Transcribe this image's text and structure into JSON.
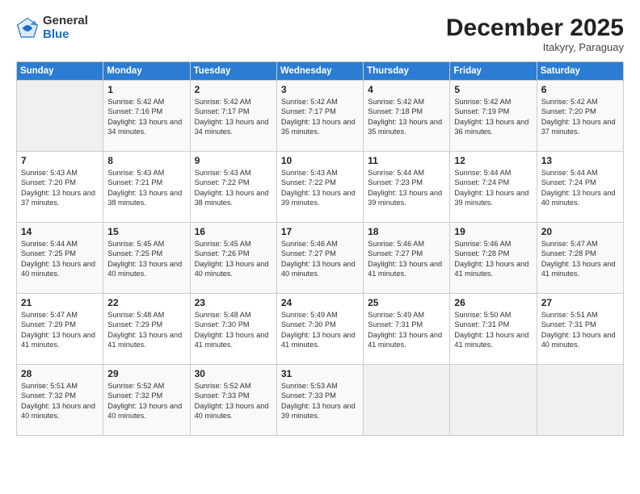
{
  "header": {
    "logo_general": "General",
    "logo_blue": "Blue",
    "month": "December 2025",
    "location": "Itakyry, Paraguay"
  },
  "days_of_week": [
    "Sunday",
    "Monday",
    "Tuesday",
    "Wednesday",
    "Thursday",
    "Friday",
    "Saturday"
  ],
  "weeks": [
    [
      {
        "day": "",
        "info": ""
      },
      {
        "day": "1",
        "sunrise": "5:42 AM",
        "sunset": "7:16 PM",
        "daylight": "13 hours and 34 minutes."
      },
      {
        "day": "2",
        "sunrise": "5:42 AM",
        "sunset": "7:17 PM",
        "daylight": "13 hours and 34 minutes."
      },
      {
        "day": "3",
        "sunrise": "5:42 AM",
        "sunset": "7:17 PM",
        "daylight": "13 hours and 35 minutes."
      },
      {
        "day": "4",
        "sunrise": "5:42 AM",
        "sunset": "7:18 PM",
        "daylight": "13 hours and 35 minutes."
      },
      {
        "day": "5",
        "sunrise": "5:42 AM",
        "sunset": "7:19 PM",
        "daylight": "13 hours and 36 minutes."
      },
      {
        "day": "6",
        "sunrise": "5:42 AM",
        "sunset": "7:20 PM",
        "daylight": "13 hours and 37 minutes."
      }
    ],
    [
      {
        "day": "7",
        "sunrise": "5:43 AM",
        "sunset": "7:20 PM",
        "daylight": "13 hours and 37 minutes."
      },
      {
        "day": "8",
        "sunrise": "5:43 AM",
        "sunset": "7:21 PM",
        "daylight": "13 hours and 38 minutes."
      },
      {
        "day": "9",
        "sunrise": "5:43 AM",
        "sunset": "7:22 PM",
        "daylight": "13 hours and 38 minutes."
      },
      {
        "day": "10",
        "sunrise": "5:43 AM",
        "sunset": "7:22 PM",
        "daylight": "13 hours and 39 minutes."
      },
      {
        "day": "11",
        "sunrise": "5:44 AM",
        "sunset": "7:23 PM",
        "daylight": "13 hours and 39 minutes."
      },
      {
        "day": "12",
        "sunrise": "5:44 AM",
        "sunset": "7:24 PM",
        "daylight": "13 hours and 39 minutes."
      },
      {
        "day": "13",
        "sunrise": "5:44 AM",
        "sunset": "7:24 PM",
        "daylight": "13 hours and 40 minutes."
      }
    ],
    [
      {
        "day": "14",
        "sunrise": "5:44 AM",
        "sunset": "7:25 PM",
        "daylight": "13 hours and 40 minutes."
      },
      {
        "day": "15",
        "sunrise": "5:45 AM",
        "sunset": "7:25 PM",
        "daylight": "13 hours and 40 minutes."
      },
      {
        "day": "16",
        "sunrise": "5:45 AM",
        "sunset": "7:26 PM",
        "daylight": "13 hours and 40 minutes."
      },
      {
        "day": "17",
        "sunrise": "5:46 AM",
        "sunset": "7:27 PM",
        "daylight": "13 hours and 40 minutes."
      },
      {
        "day": "18",
        "sunrise": "5:46 AM",
        "sunset": "7:27 PM",
        "daylight": "13 hours and 41 minutes."
      },
      {
        "day": "19",
        "sunrise": "5:46 AM",
        "sunset": "7:28 PM",
        "daylight": "13 hours and 41 minutes."
      },
      {
        "day": "20",
        "sunrise": "5:47 AM",
        "sunset": "7:28 PM",
        "daylight": "13 hours and 41 minutes."
      }
    ],
    [
      {
        "day": "21",
        "sunrise": "5:47 AM",
        "sunset": "7:29 PM",
        "daylight": "13 hours and 41 minutes."
      },
      {
        "day": "22",
        "sunrise": "5:48 AM",
        "sunset": "7:29 PM",
        "daylight": "13 hours and 41 minutes."
      },
      {
        "day": "23",
        "sunrise": "5:48 AM",
        "sunset": "7:30 PM",
        "daylight": "13 hours and 41 minutes."
      },
      {
        "day": "24",
        "sunrise": "5:49 AM",
        "sunset": "7:30 PM",
        "daylight": "13 hours and 41 minutes."
      },
      {
        "day": "25",
        "sunrise": "5:49 AM",
        "sunset": "7:31 PM",
        "daylight": "13 hours and 41 minutes."
      },
      {
        "day": "26",
        "sunrise": "5:50 AM",
        "sunset": "7:31 PM",
        "daylight": "13 hours and 41 minutes."
      },
      {
        "day": "27",
        "sunrise": "5:51 AM",
        "sunset": "7:31 PM",
        "daylight": "13 hours and 40 minutes."
      }
    ],
    [
      {
        "day": "28",
        "sunrise": "5:51 AM",
        "sunset": "7:32 PM",
        "daylight": "13 hours and 40 minutes."
      },
      {
        "day": "29",
        "sunrise": "5:52 AM",
        "sunset": "7:32 PM",
        "daylight": "13 hours and 40 minutes."
      },
      {
        "day": "30",
        "sunrise": "5:52 AM",
        "sunset": "7:33 PM",
        "daylight": "13 hours and 40 minutes."
      },
      {
        "day": "31",
        "sunrise": "5:53 AM",
        "sunset": "7:33 PM",
        "daylight": "13 hours and 39 minutes."
      },
      {
        "day": "",
        "info": ""
      },
      {
        "day": "",
        "info": ""
      },
      {
        "day": "",
        "info": ""
      }
    ]
  ]
}
